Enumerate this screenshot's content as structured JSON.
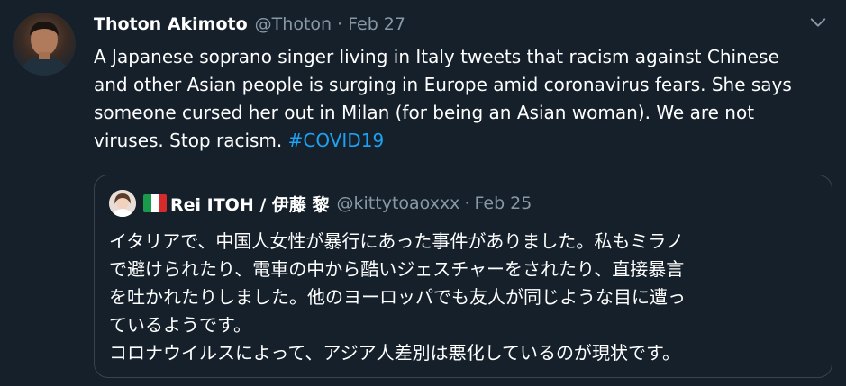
{
  "tweet": {
    "author": {
      "display_name": "Thoton Akimoto",
      "handle": "@Thoton",
      "avatar_icon": "user-avatar-icon"
    },
    "separator": "·",
    "date": "Feb 27",
    "text_lines": [
      "A Japanese soprano singer living in Italy tweets that racism against Chinese",
      "and other Asian people is surging in Europe amid coronavirus fears. She says",
      "someone cursed her out in Milan (for being an Asian woman). We are not",
      "viruses. Stop racism. "
    ],
    "hashtag": "#COVID19",
    "menu_icon": "chevron-down-icon"
  },
  "quote": {
    "author": {
      "display_name": "Rei ITOH / 伊藤 黎",
      "handle": "@kittytoaoxxx",
      "flag_icon": "italy-flag-icon",
      "avatar_icon": "user-avatar-icon"
    },
    "separator": "·",
    "date": "Feb 25",
    "text_lines": [
      "イタリアで、中国人女性が暴行にあった事件がありました。私もミラノ",
      "で避けられたり、電車の中から酷いジェスチャーをされたり、直接暴言",
      "を吐かれたりしました。他のヨーロッパでも友人が同じような目に遭っ",
      "ているようです。",
      "コロナウイルスによって、アジア人差別は悪化しているのが現状です。"
    ]
  },
  "colors": {
    "background": "#15202b",
    "text": "#ffffff",
    "secondary_text": "#8899a6",
    "link": "#1da1f2",
    "border": "#38444d"
  }
}
